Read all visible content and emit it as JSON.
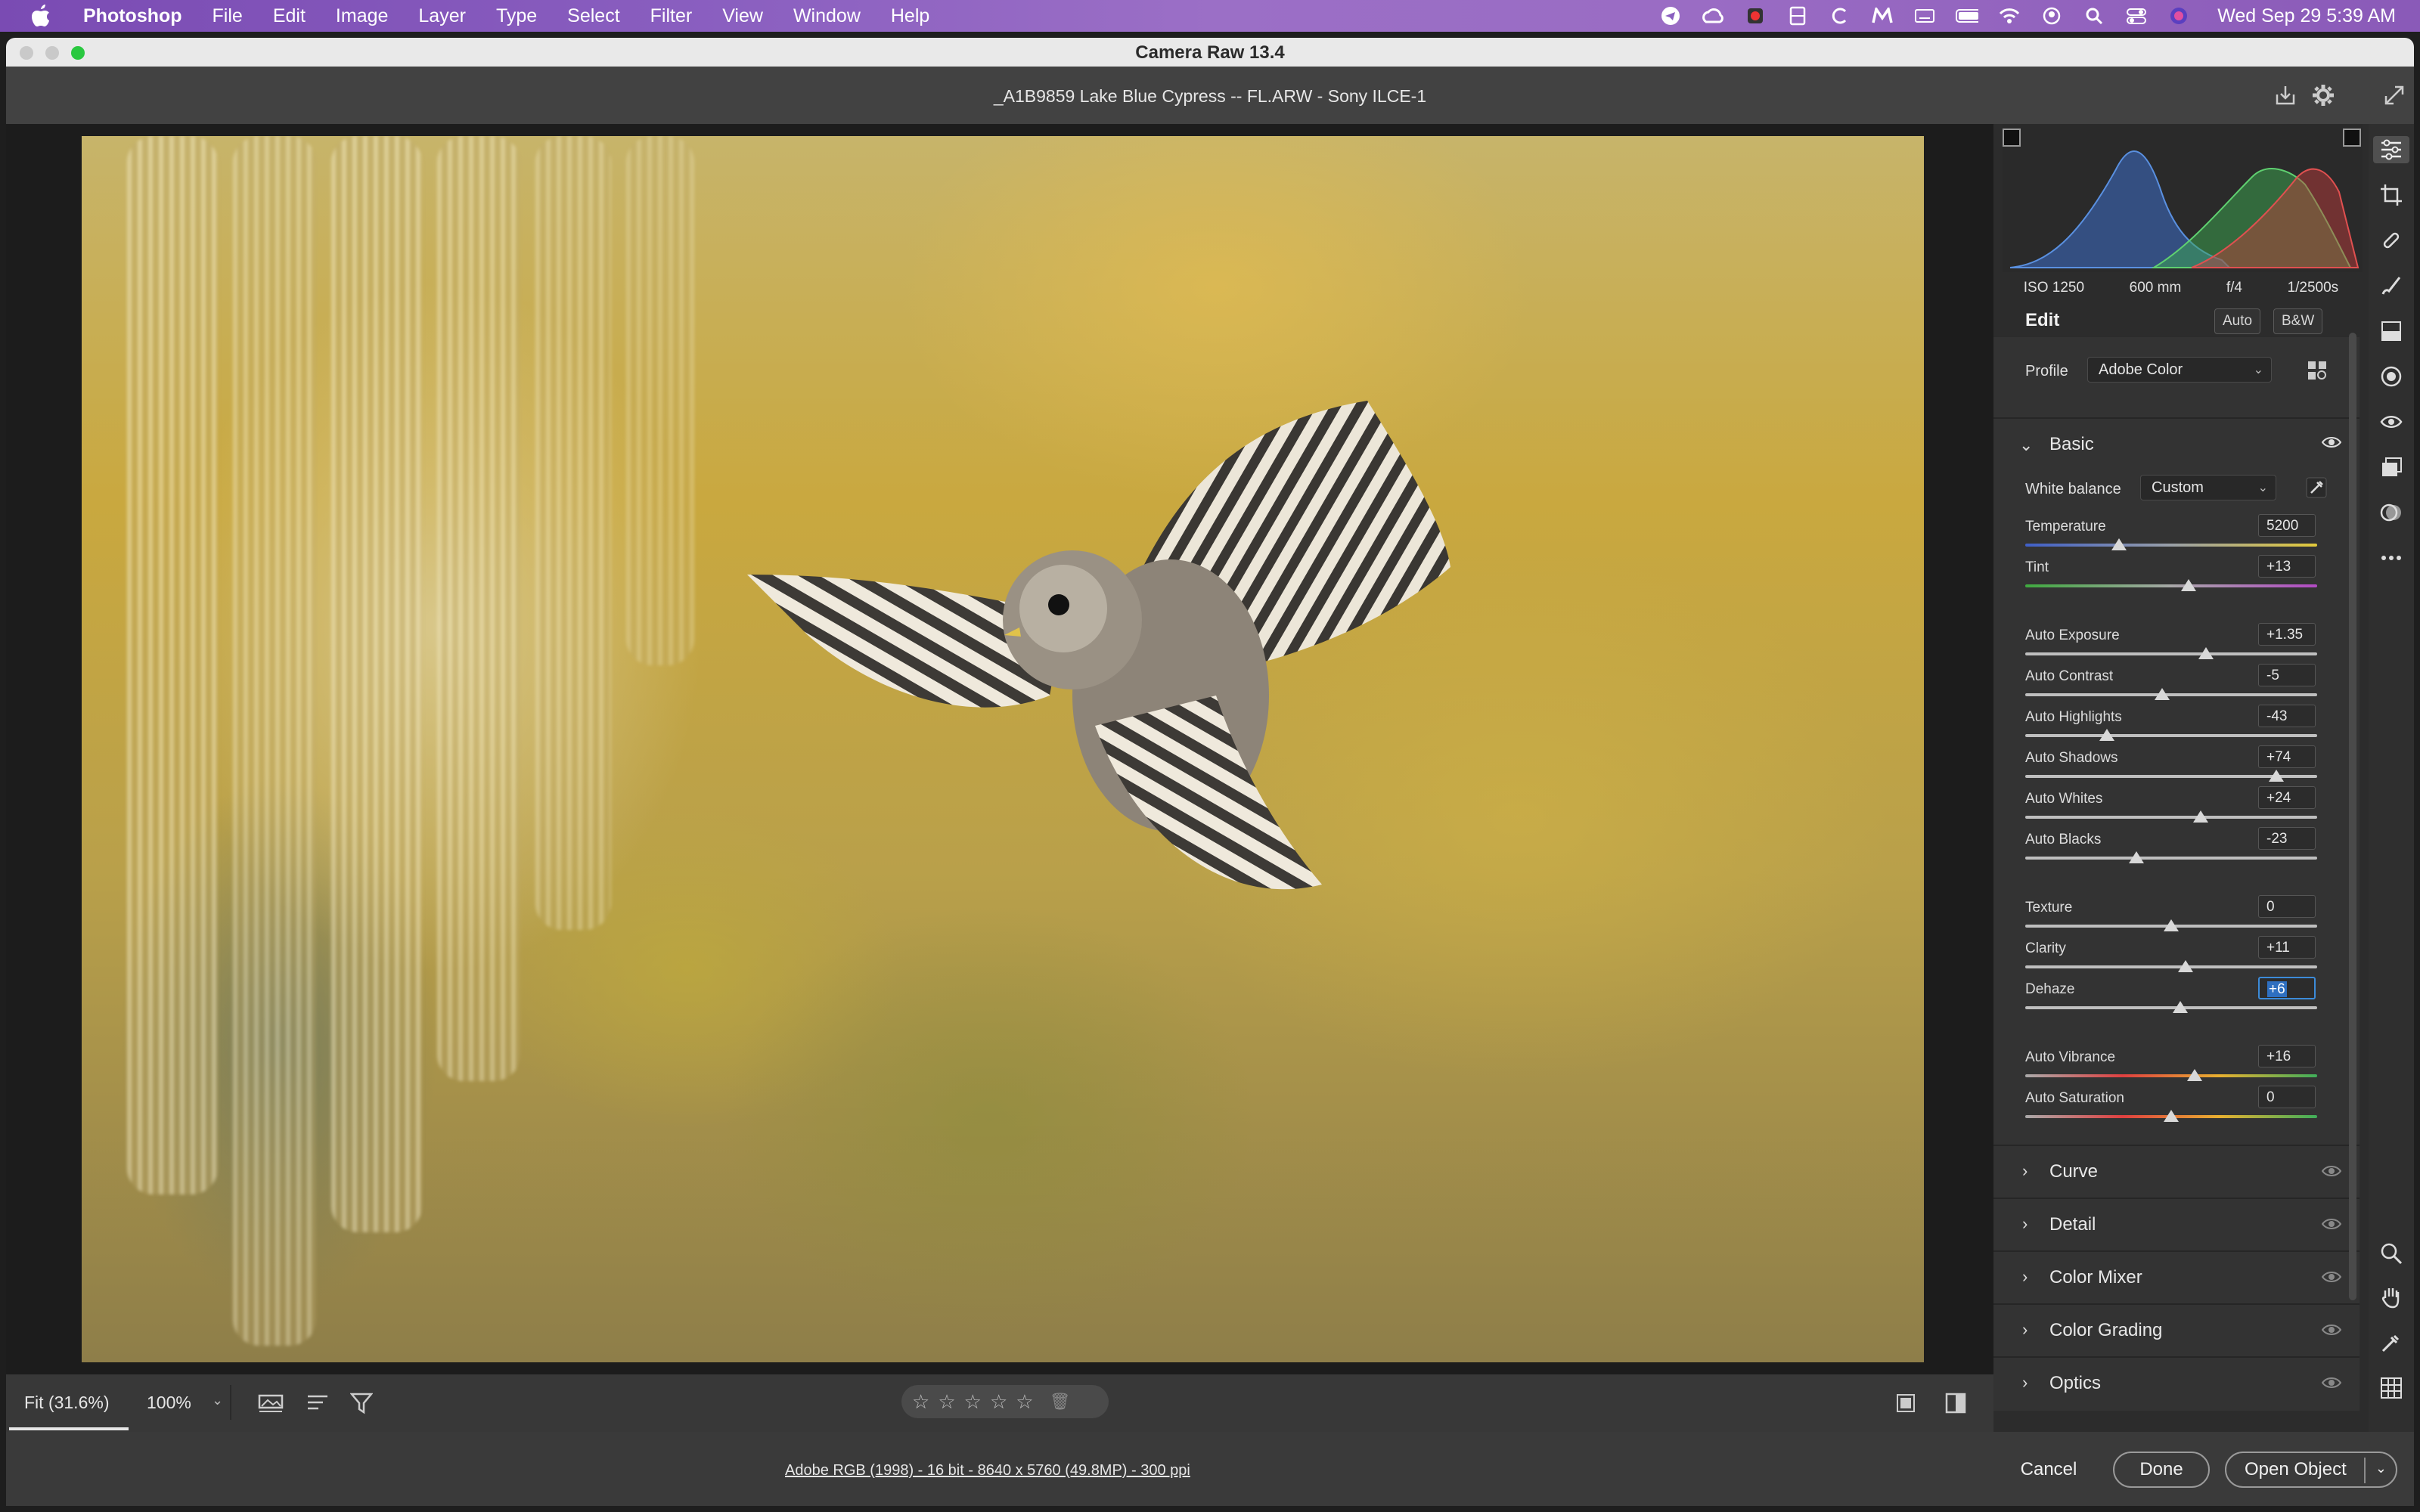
{
  "menubar": {
    "app_name": "Photoshop",
    "items": [
      "File",
      "Edit",
      "Image",
      "Layer",
      "Type",
      "Select",
      "Filter",
      "View",
      "Window",
      "Help"
    ],
    "clock": "Wed Sep 29  5:39 AM"
  },
  "window": {
    "title": "Camera Raw 13.4"
  },
  "header": {
    "file_title": "_A1B9859 Lake Blue Cypress -- FL.ARW  -  Sony ILCE-1"
  },
  "exif": {
    "iso": "ISO 1250",
    "focal": "600 mm",
    "aperture": "f/4",
    "shutter": "1/2500s"
  },
  "edit": {
    "title": "Edit",
    "auto_label": "Auto",
    "bw_label": "B&W"
  },
  "profile": {
    "label": "Profile",
    "value": "Adobe Color"
  },
  "basic": {
    "title": "Basic",
    "white_balance_label": "White balance",
    "white_balance_value": "Custom",
    "sliders": [
      {
        "label": "Temperature",
        "value": "5200",
        "pos": 0.32,
        "track": "temp"
      },
      {
        "label": "Tint",
        "value": "+13",
        "pos": 0.56,
        "track": "tint"
      },
      {
        "label": "Auto Exposure",
        "value": "+1.35",
        "pos": 0.62,
        "track": ""
      },
      {
        "label": "Auto Contrast",
        "value": "-5",
        "pos": 0.47,
        "track": ""
      },
      {
        "label": "Auto Highlights",
        "value": "-43",
        "pos": 0.28,
        "track": ""
      },
      {
        "label": "Auto Shadows",
        "value": "+74",
        "pos": 0.86,
        "track": ""
      },
      {
        "label": "Auto Whites",
        "value": "+24",
        "pos": 0.6,
        "track": ""
      },
      {
        "label": "Auto Blacks",
        "value": "-23",
        "pos": 0.38,
        "track": ""
      },
      {
        "label": "Texture",
        "value": "0",
        "pos": 0.5,
        "track": ""
      },
      {
        "label": "Clarity",
        "value": "+11",
        "pos": 0.55,
        "track": ""
      },
      {
        "label": "Dehaze",
        "value": "+6",
        "pos": 0.53,
        "track": "",
        "active": true
      },
      {
        "label": "Auto Vibrance",
        "value": "+16",
        "pos": 0.58,
        "track": "vib"
      },
      {
        "label": "Auto Saturation",
        "value": "0",
        "pos": 0.5,
        "track": "vib"
      }
    ]
  },
  "sections": [
    "Curve",
    "Detail",
    "Color Mixer",
    "Color Grading",
    "Optics"
  ],
  "bottombar": {
    "zoom_fit": "Fit (31.6%)",
    "zoom_100": "100%"
  },
  "footer": {
    "workflow_info": "Adobe RGB (1998) - 16 bit - 8640 x 5760 (49.8MP) - 300 ppi",
    "cancel": "Cancel",
    "done": "Done",
    "open_object": "Open Object"
  }
}
